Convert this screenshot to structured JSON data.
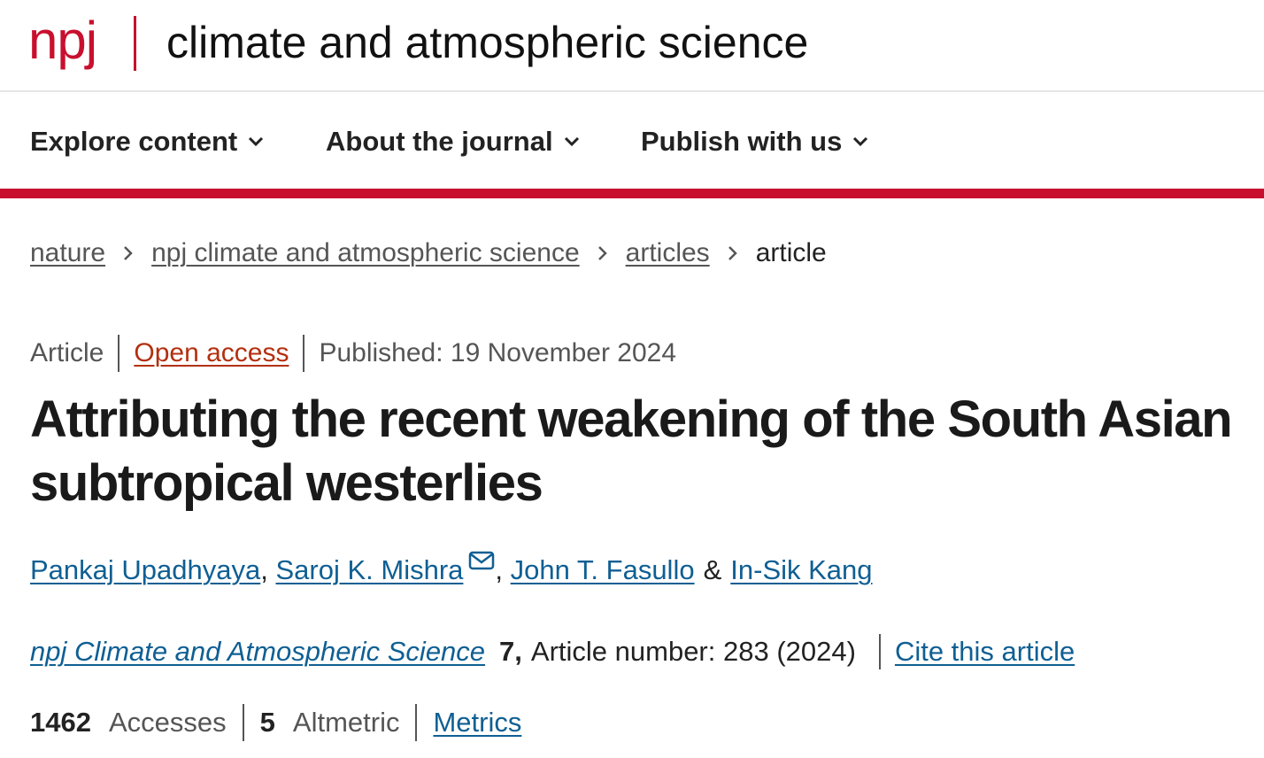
{
  "header": {
    "logo_text": "npj",
    "journal_title": "climate and atmospheric science"
  },
  "nav": {
    "items": [
      {
        "label": "Explore content",
        "icon": "chevron-down-icon"
      },
      {
        "label": "About the journal",
        "icon": "chevron-down-icon"
      },
      {
        "label": "Publish with us",
        "icon": "chevron-down-icon"
      }
    ],
    "accent_color": "#c8102e"
  },
  "breadcrumb": {
    "items": [
      "nature",
      "npj climate and atmospheric science",
      "articles"
    ],
    "current": "article",
    "separator_icon": "chevron-right-icon"
  },
  "article": {
    "type": "Article",
    "access": "Open access",
    "published": "Published: 19 November 2024",
    "title": "Attributing the recent weakening of the South Asian subtropical westerlies",
    "authors": [
      {
        "name": "Pankaj Upadhyaya"
      },
      {
        "name": "Saroj K. Mishra",
        "icon": "mail-icon"
      },
      {
        "name": "John T. Fasullo"
      },
      {
        "name": "In-Sik Kang"
      }
    ],
    "author_separator": ",",
    "author_last_joiner": "&"
  },
  "citation": {
    "journal": "npj Climate and Atmospheric Science",
    "volume": "7,",
    "article_number": "Article number: 283 (2024)",
    "cite_link": "Cite this article"
  },
  "metrics": {
    "accesses_count": "1462",
    "accesses_label": "Accesses",
    "altmetric_count": "5",
    "altmetric_label": "Altmetric",
    "metrics_link": "Metrics"
  },
  "colors": {
    "brand_red": "#c8102e",
    "link_blue": "#0f5f93",
    "open_access_orange": "#b3300f"
  }
}
